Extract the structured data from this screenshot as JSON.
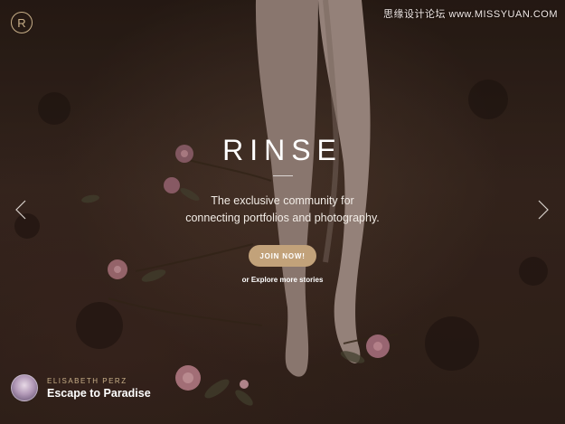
{
  "brand": {
    "logo_glyph": "R",
    "title": "RINSE",
    "accent_color": "#c2a27a"
  },
  "watermark": "思缘设计论坛 www.MISSYUAN.COM",
  "hero": {
    "tagline_line1": "The exclusive community for",
    "tagline_line2": "connecting portfolios and photography.",
    "join_label": "JOIN NOW!",
    "explore_label": "or Explore more stories"
  },
  "navigation": {
    "prev_icon": "chevron-left-icon",
    "next_icon": "chevron-right-icon"
  },
  "featured": {
    "author": "ELISABETH PERZ",
    "story": "Escape to Paradise"
  }
}
